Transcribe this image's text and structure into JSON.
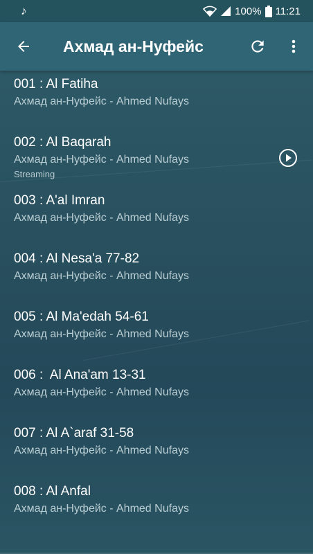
{
  "status_bar": {
    "battery_percent": "100%",
    "time": "11:21",
    "icons": [
      "music-note-icon",
      "wifi-icon",
      "signal-icon",
      "battery-icon"
    ]
  },
  "app_bar": {
    "title": "Ахмад ан-Нуфейс",
    "icons": [
      "back-arrow-icon",
      "refresh-icon",
      "more-vert-icon"
    ]
  },
  "list": {
    "items": [
      {
        "title": "001 : Al Fatiha",
        "subtitle": "Ахмад ан-Нуфейс - Ahmed Nufays"
      },
      {
        "title": "002 : Al Baqarah",
        "subtitle": "Ахмад ан-Нуфейс - Ahmed Nufays",
        "status": "Streaming",
        "playing": true
      },
      {
        "title": "003 : A'al Imran",
        "subtitle": "Ахмад ан-Нуфейс - Ahmed Nufays"
      },
      {
        "title": "004 : Al Nesa'a 77-82",
        "subtitle": "Ахмад ан-Нуфейс - Ahmed Nufays"
      },
      {
        "title": "005 : Al Ma'edah 54-61",
        "subtitle": "Ахмад ан-Нуфейс - Ahmed Nufays"
      },
      {
        "title": "006 :  Al Ana'am 13-31",
        "subtitle": "Ахмад ан-Нуфейс - Ahmed Nufays"
      },
      {
        "title": "007 : Al A`araf 31-58",
        "subtitle": "Ахмад ан-Нуфейс - Ahmed Nufays"
      },
      {
        "title": "008 : Al Anfal",
        "subtitle": "Ахмад ан-Нуфейс - Ahmed Nufays"
      }
    ]
  },
  "colors": {
    "app_bar": "#2f6574",
    "status_bar": "#24535e",
    "background": "#2a5260",
    "subtitle_text": "#b9cdd3"
  }
}
